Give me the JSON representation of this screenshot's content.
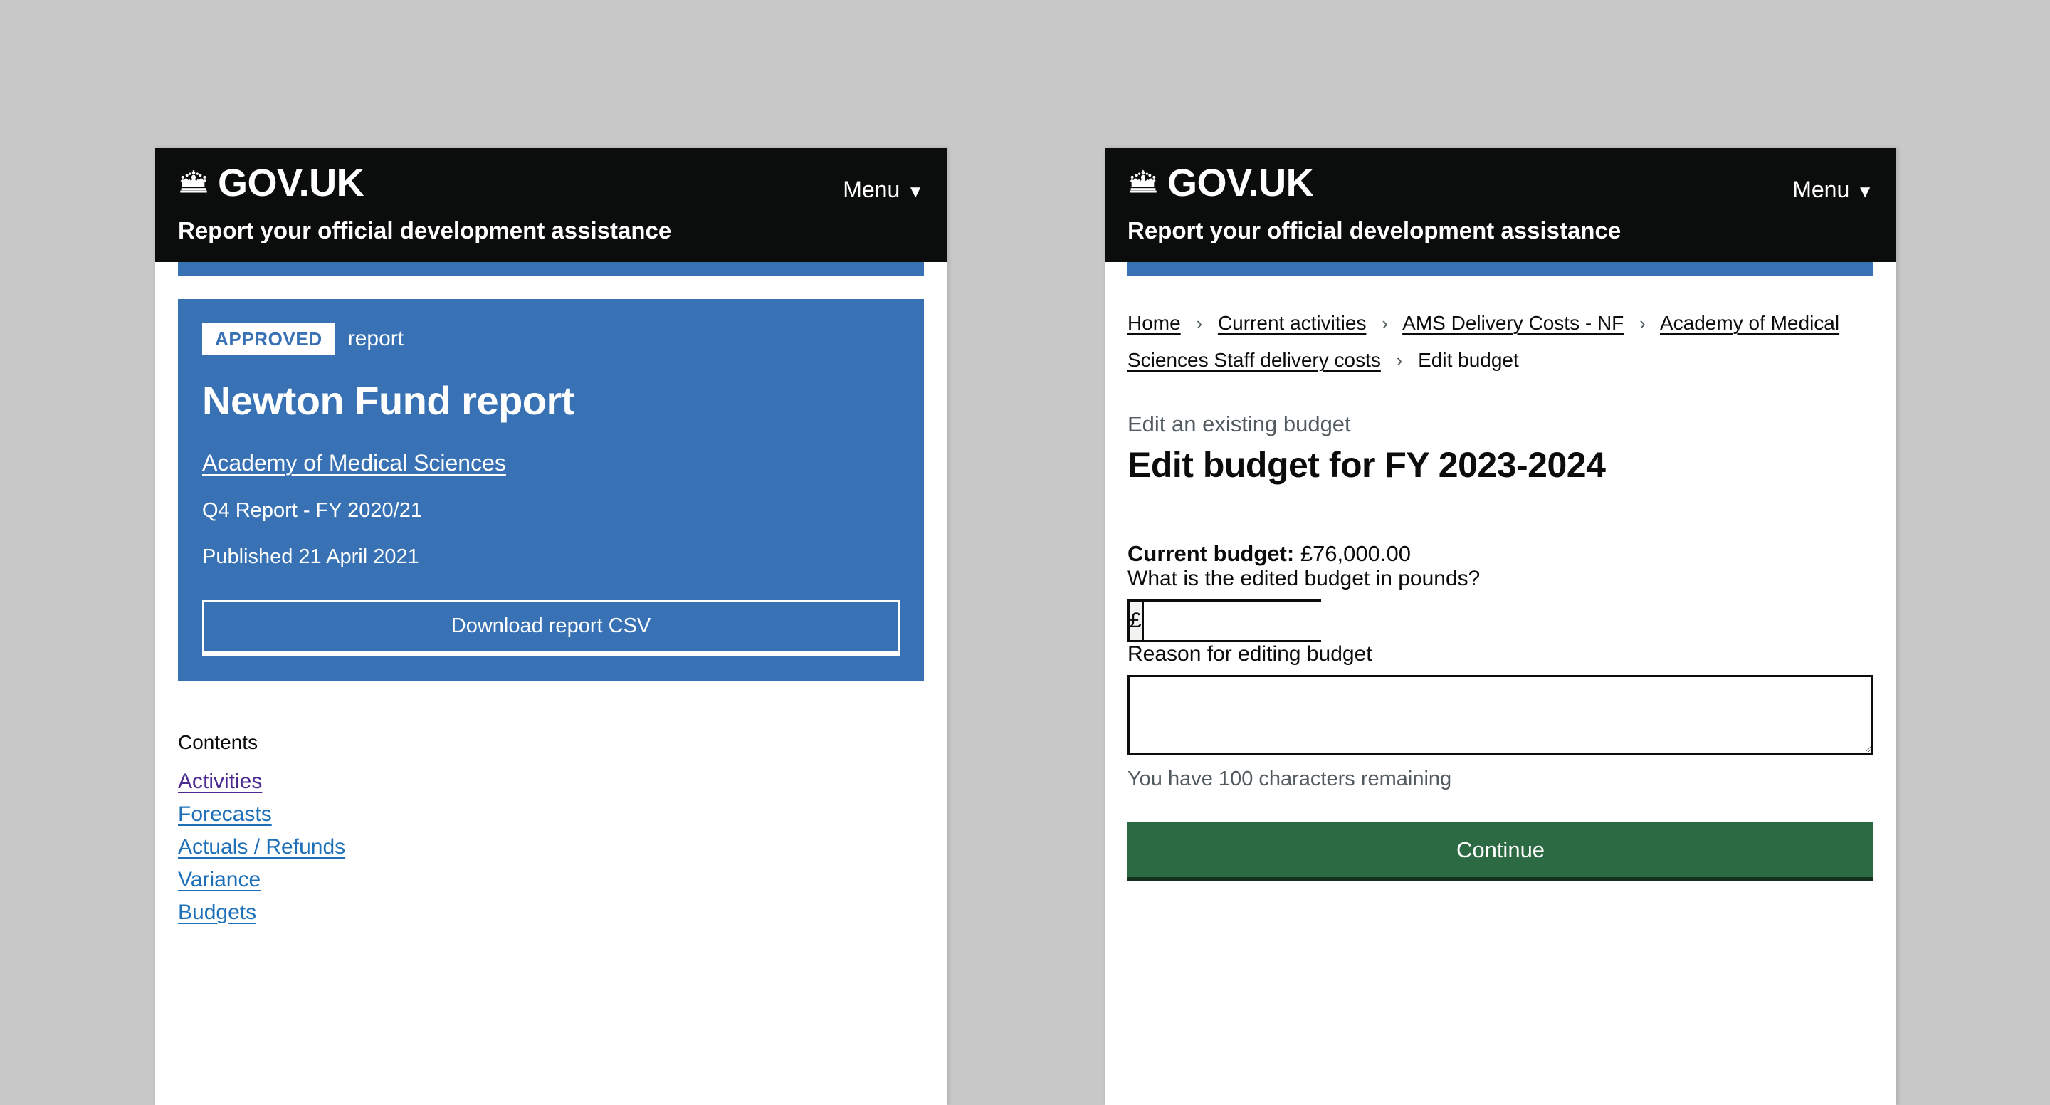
{
  "header": {
    "brand_name": "GOV.UK",
    "crown_icon": "crown-icon",
    "menu_label": "Menu",
    "menu_caret": "▼",
    "service_name": "Report your official development assistance"
  },
  "left_panel": {
    "report_card": {
      "badge": "APPROVED",
      "badge_suffix": "report",
      "title": "Newton Fund report",
      "organisation_link": "Academy of Medical Sciences",
      "quarter": "Q4 Report - FY 2020/21",
      "published": "Published 21 April 2021",
      "download_button": "Download report CSV"
    },
    "contents": {
      "heading": "Contents",
      "items": [
        {
          "label": "Activities",
          "visited": true
        },
        {
          "label": "Forecasts",
          "visited": false
        },
        {
          "label": "Actuals / Refunds",
          "visited": false
        },
        {
          "label": "Variance",
          "visited": false
        },
        {
          "label": "Budgets",
          "visited": false
        }
      ]
    }
  },
  "right_panel": {
    "breadcrumbs": [
      {
        "label": "Home",
        "current": false
      },
      {
        "label": "Current activities",
        "current": false
      },
      {
        "label": "AMS Delivery Costs - NF",
        "current": false
      },
      {
        "label": "Academy of Medical Sciences Staff delivery costs",
        "current": false
      },
      {
        "label": "Edit budget",
        "current": true
      }
    ],
    "breadcrumb_separator": "›",
    "caption": "Edit an existing budget",
    "page_heading": "Edit budget for FY 2023-2024",
    "current_budget_label": "Current budget:",
    "current_budget_value": "£76,000.00",
    "budget_field": {
      "label": "What is the edited budget in pounds?",
      "currency_symbol": "£",
      "value": "",
      "placeholder": ""
    },
    "reason_field": {
      "label": "Reason for editing budget",
      "value": "",
      "placeholder": "",
      "hint": "You have 100 characters remaining"
    },
    "continue_button": "Continue"
  },
  "colors": {
    "govuk_black": "#0b0c0c",
    "report_blue": "#3872b5",
    "link_blue": "#1d70b8",
    "link_visited": "#4c2c92",
    "button_green": "#2b6a43",
    "page_background": "#c8c8c8"
  }
}
